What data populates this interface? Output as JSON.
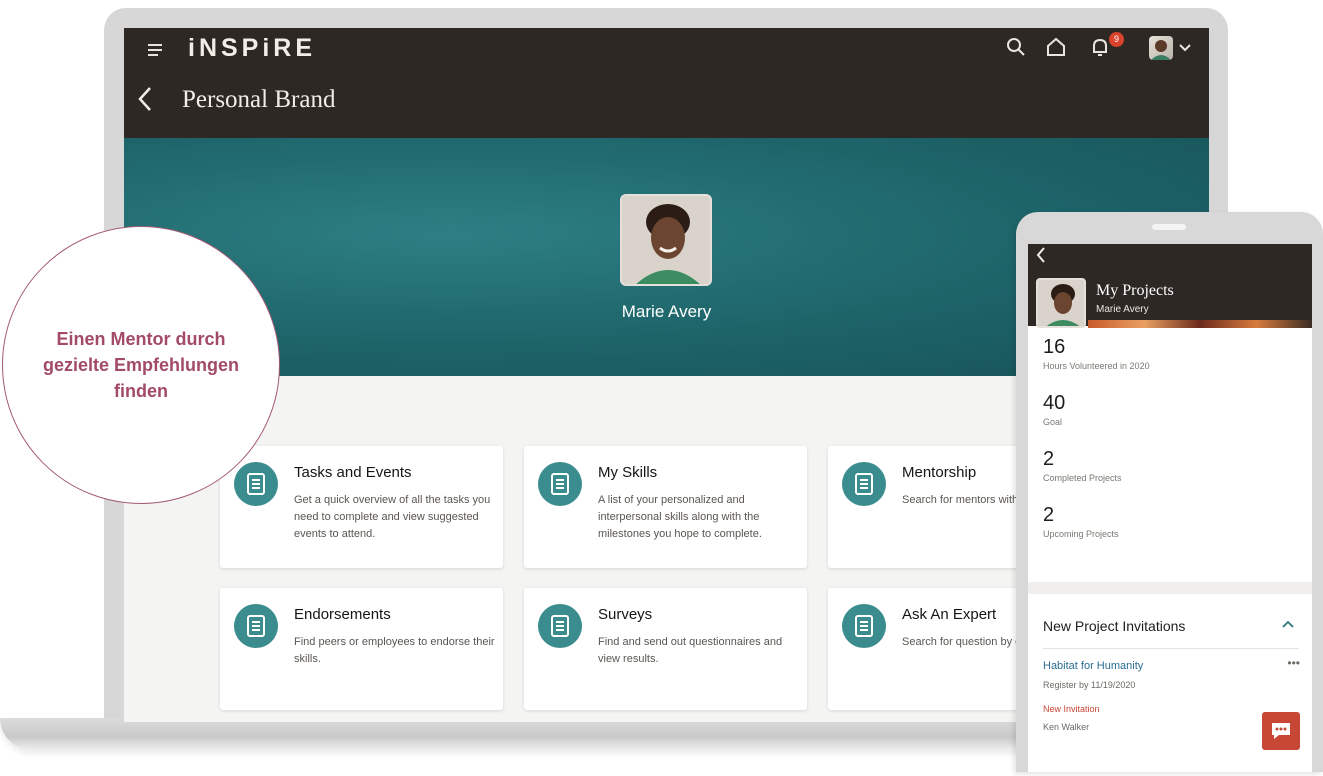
{
  "app": {
    "brand": "iNSPiRE",
    "notification_count": "9"
  },
  "page": {
    "title": "Personal Brand"
  },
  "profile": {
    "name": "Marie Avery"
  },
  "cards": [
    {
      "title": "Tasks and Events",
      "desc": "Get a quick overview of all the tasks you need to complete and view suggested events to attend."
    },
    {
      "title": "My Skills",
      "desc": "A list of your personalized and interpersonal skills along with the milestones you hope to complete."
    },
    {
      "title": "Mentorship",
      "desc": "Search for mentors with your mentors a"
    },
    {
      "title": "Endorsements",
      "desc": "Find peers or employees to endorse their skills."
    },
    {
      "title": "Surveys",
      "desc": "Find and send out questionnaires and view results."
    },
    {
      "title": "Ask An Expert",
      "desc": "Search for question by experts or create"
    }
  ],
  "callout": {
    "text": "Einen Mentor durch gezielte Empfehlungen finden"
  },
  "phone": {
    "title": "My Projects",
    "subtitle": "Marie Avery",
    "stats": [
      {
        "value": "16",
        "label": "Hours Volunteered in 2020"
      },
      {
        "value": "40",
        "label": "Goal"
      },
      {
        "value": "2",
        "label": "Completed Projects"
      },
      {
        "value": "2",
        "label": "Upcoming Projects"
      }
    ],
    "invitations": {
      "heading": "New Project Invitations",
      "name": "Habitat for Humanity",
      "register": "Register by 11/19/2020",
      "status": "New Invitation",
      "person": "Ken Walker"
    }
  },
  "colors": {
    "header": "#2d2824",
    "teal": "#1d6469",
    "accent": "#c74634",
    "callout": "#a24a68"
  },
  "icons": [
    "menu-icon",
    "search-icon",
    "home-icon",
    "bell-icon",
    "chevron-down-icon",
    "back-icon",
    "document-icon",
    "chevron-up-icon",
    "more-icon",
    "chat-icon"
  ]
}
